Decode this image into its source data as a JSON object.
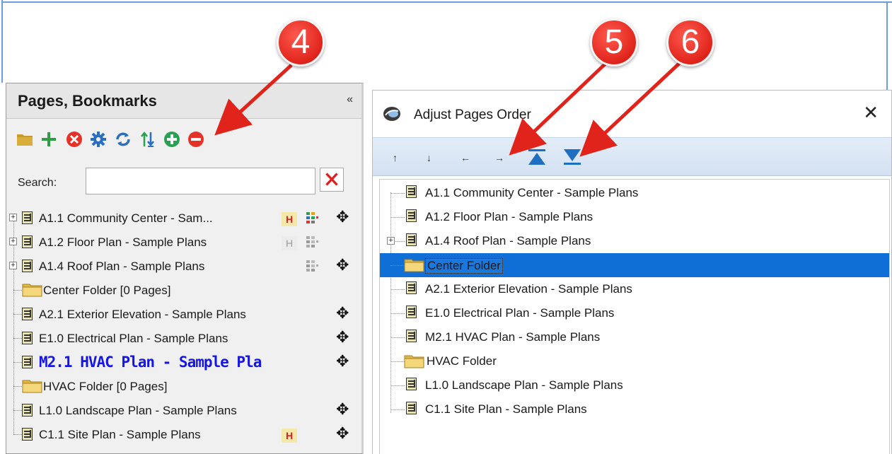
{
  "left_panel": {
    "title": "Pages, Bookmarks",
    "collapse_glyph": "«",
    "toolbar_icons": [
      "folder-icon",
      "add-icon",
      "delete-icon",
      "settings-icon",
      "refresh-icon",
      "sort-icon",
      "expand-all-icon",
      "collapse-all-icon"
    ],
    "search": {
      "label": "Search:",
      "value": "",
      "clear_glyph": "✕"
    },
    "items": [
      {
        "label": "A1.1 Community Center - Sam...",
        "type": "page"
      },
      {
        "label": "A1.2 Floor Plan - Sample Plans",
        "type": "page"
      },
      {
        "label": "A1.4 Roof Plan - Sample Plans",
        "type": "page"
      },
      {
        "label": "Center Folder [0 Pages]",
        "type": "folder"
      },
      {
        "label": "A2.1 Exterior Elevation - Sample Plans",
        "type": "page"
      },
      {
        "label": "E1.0 Electrical Plan - Sample Plans",
        "type": "page"
      },
      {
        "label": "M2.1 HVAC Plan - Sample Pla",
        "type": "page",
        "active": true
      },
      {
        "label": "HVAC Folder [0 Pages]",
        "type": "folder"
      },
      {
        "label": "L1.0 Landscape Plan - Sample Plans",
        "type": "page"
      },
      {
        "label": "C1.1 Site Plan - Sample Plans",
        "type": "page"
      }
    ],
    "move_glyph": "✥",
    "h_glyph": "H"
  },
  "dialog": {
    "title": "Adjust Pages Order",
    "close_glyph": "✕",
    "items": [
      {
        "label": "A1.1 Community Center - Sample Plans",
        "type": "page"
      },
      {
        "label": "A1.2 Floor Plan - Sample Plans",
        "type": "page"
      },
      {
        "label": "A1.4 Roof Plan - Sample Plans",
        "type": "page"
      },
      {
        "label": "Center Folder",
        "type": "folder",
        "selected": true
      },
      {
        "label": "A2.1 Exterior Elevation - Sample Plans",
        "type": "page"
      },
      {
        "label": "E1.0 Electrical Plan - Sample Plans",
        "type": "page"
      },
      {
        "label": "M2.1 HVAC Plan - Sample Plans",
        "type": "page"
      },
      {
        "label": "HVAC Folder",
        "type": "folder"
      },
      {
        "label": "L1.0 Landscape Plan - Sample Plans",
        "type": "page"
      },
      {
        "label": "C1.1 Site Plan - Sample Plans",
        "type": "page"
      }
    ],
    "toolbar": {
      "move_up_glyph": "↑",
      "move_down_glyph": "↓",
      "move_left_glyph": "←",
      "move_right_glyph": "→"
    }
  },
  "annotations": {
    "badge_4": "4",
    "badge_5": "5",
    "badge_6": "6"
  },
  "colors": {
    "badge_red": "#e0241b",
    "selection_blue": "#0f6fd6",
    "active_page_blue": "#1515e6",
    "markup_red": "#d8232a"
  }
}
